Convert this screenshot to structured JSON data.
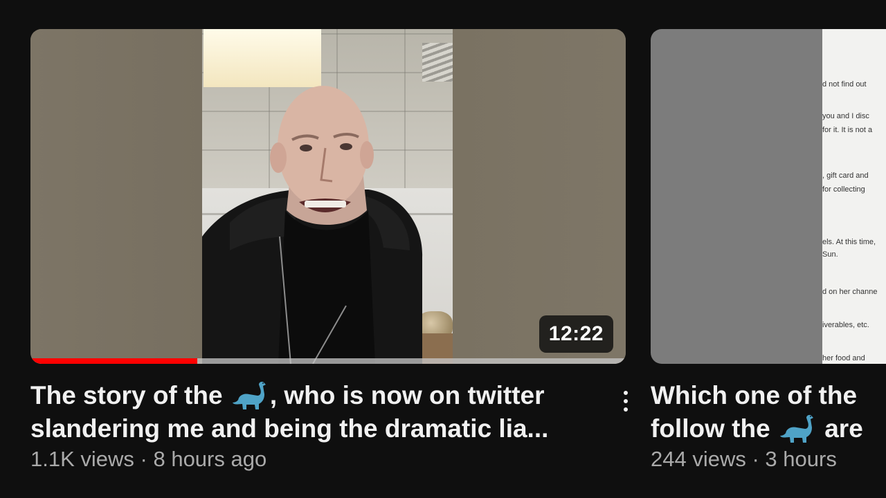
{
  "feed": {
    "videos": [
      {
        "title_line1_pre": "The story of the ",
        "title_line1_post": ", who is now on twitter",
        "title_line2": "slandering me and being the dramatic lia...",
        "title_emoji": "sauropod-emoji",
        "views": "1.1K views",
        "separator": " · ",
        "age": "8 hours ago",
        "duration": "12:22",
        "watch_progress": 0.28,
        "progress_color": "#ff0000",
        "more_actions_icon": "kebab-vertical-icon"
      },
      {
        "title_line1": "Which one of the",
        "title_line2_pre": "follow the ",
        "title_line2_post": " are",
        "title_emoji": "sauropod-emoji",
        "views": "244 views",
        "separator": " · ",
        "age": "3 hours",
        "thumbnail_text_lines": [
          "d not find out",
          "you and I disc",
          "for it. It is not a",
          ", gift card and",
          "for collecting",
          "els. At this time,",
          "Sun.",
          "d on her channe",
          "iverables, etc.",
          "her food and"
        ]
      }
    ]
  },
  "theme": {
    "background": "#0f0f0f",
    "title_color": "#f1f1f1",
    "meta_color": "#aaaaaa"
  }
}
